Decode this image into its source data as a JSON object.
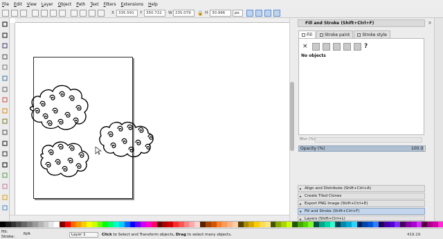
{
  "menu": [
    "File",
    "Edit",
    "View",
    "Layer",
    "Object",
    "Path",
    "Text",
    "Filters",
    "Extensions",
    "Help"
  ],
  "tool_controls": {
    "x_label": "X",
    "x_value": "335.591",
    "y_label": "Y",
    "y_value": "350.722",
    "w_label": "W",
    "w_value": "235.079",
    "h_label": "H",
    "h_value": "30.996",
    "unit": "px"
  },
  "tools": [
    "selector-tool",
    "node-tool",
    "tweak-tool",
    "zoom-tool",
    "measure-tool",
    "rectangle-tool",
    "3dbox-tool",
    "ellipse-tool",
    "star-tool",
    "spiral-tool",
    "pencil-tool",
    "pen-tool",
    "calligraphy-tool",
    "text-tool",
    "spray-tool",
    "eraser-tool",
    "bucket-tool",
    "gradient-tool"
  ],
  "dialog": {
    "title": "Fill and Stroke (Shift+Ctrl+F)",
    "tabs": [
      "Fill",
      "Stroke paint",
      "Stroke style"
    ],
    "no_objects": "No objects",
    "blur_label": "Blur (%)",
    "opacity_label": "Opacity (%)",
    "opacity_value": "100.0"
  },
  "docked_dialogs": [
    "Align and Distribute (Shift+Ctrl+A)",
    "Create Tiled Clones",
    "Export PNG Image (Shift+Ctrl+E)",
    "Fill and Stroke (Shift+Ctrl+F)",
    "Layers (Shift+Ctrl+L)"
  ],
  "palette": [
    "#000000",
    "#1a1a1a",
    "#333333",
    "#4d4d4d",
    "#666666",
    "#808080",
    "#999999",
    "#b3b3b3",
    "#cccccc",
    "#e6e6e6",
    "#ffffff",
    "#800000",
    "#ff0000",
    "#ff6600",
    "#ff9900",
    "#ffcc00",
    "#ffff00",
    "#ccff00",
    "#66ff00",
    "#00ff00",
    "#00ff66",
    "#00ffcc",
    "#00ccff",
    "#0066ff",
    "#0000ff",
    "#6600ff",
    "#cc00ff",
    "#ff00cc",
    "#ff0066",
    "#550000",
    "#aa0000",
    "#d40000",
    "#ff2a2a",
    "#ff5555",
    "#ff8080",
    "#ffaaaa",
    "#ffd5d5",
    "#552200",
    "#aa4400",
    "#d45500",
    "#ff7f2a",
    "#ff9955",
    "#ffb380",
    "#ffccaa",
    "#554400",
    "#aa8800",
    "#d4aa00",
    "#ffcc00",
    "#ffdd55",
    "#ffe680",
    "#445500",
    "#88aa00",
    "#aad400",
    "#ccff00",
    "#225500",
    "#44aa00",
    "#55d400",
    "#7fff2a",
    "#005544",
    "#00aa88",
    "#00d4aa",
    "#2affd5",
    "#004455",
    "#0088aa",
    "#00aad4",
    "#2ad4ff",
    "#002255",
    "#0044aa",
    "#0055d4",
    "#2a7fff",
    "#220055",
    "#4400aa",
    "#5500d4",
    "#7f2aff",
    "#440055",
    "#8800aa",
    "#aa00d4",
    "#d42aff",
    "#550044",
    "#aa0088",
    "#d400aa",
    "#ff2ad4"
  ],
  "status": {
    "fill_label": "Fill:",
    "stroke_label": "Stroke:",
    "fill_value": "N/A",
    "layer": "Layer 1",
    "message_bold1": "Click",
    "message_mid": " to Select and Transform objects, ",
    "message_bold2": "Drag",
    "message_end": " to select many objects.",
    "coords": "419.19"
  }
}
